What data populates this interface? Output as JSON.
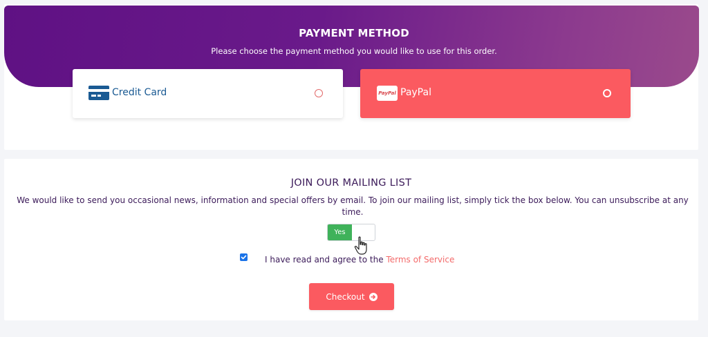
{
  "payment": {
    "title": "PAYMENT METHOD",
    "subtitle": "Please choose the payment method you would like to use for this order.",
    "methods": [
      {
        "label": "Credit Card",
        "icon": "credit-card-icon",
        "selected": false
      },
      {
        "label": "PayPal",
        "icon": "paypal-logo-icon",
        "logo_text": "PayPal",
        "selected": true
      }
    ]
  },
  "mailing": {
    "title": "JOIN OUR MAILING LIST",
    "description": "We would like to send you occasional news, information and special offers by email. To join our mailing list, simply tick the box below. You can unsubscribe at any time.",
    "toggle_label": "Yes",
    "toggle_on": true
  },
  "terms": {
    "checked": true,
    "text": "I have read and agree to the ",
    "link_text": "Terms of Service"
  },
  "checkout": {
    "label": "Checkout",
    "icon": "arrow-circle-right-icon"
  },
  "colors": {
    "accent": "#fb5a60",
    "hero_purple": "#5f1184",
    "text_dark": "#3b1a59",
    "credit_blue": "#1a5a93",
    "toggle_green": "#3fb25a"
  }
}
